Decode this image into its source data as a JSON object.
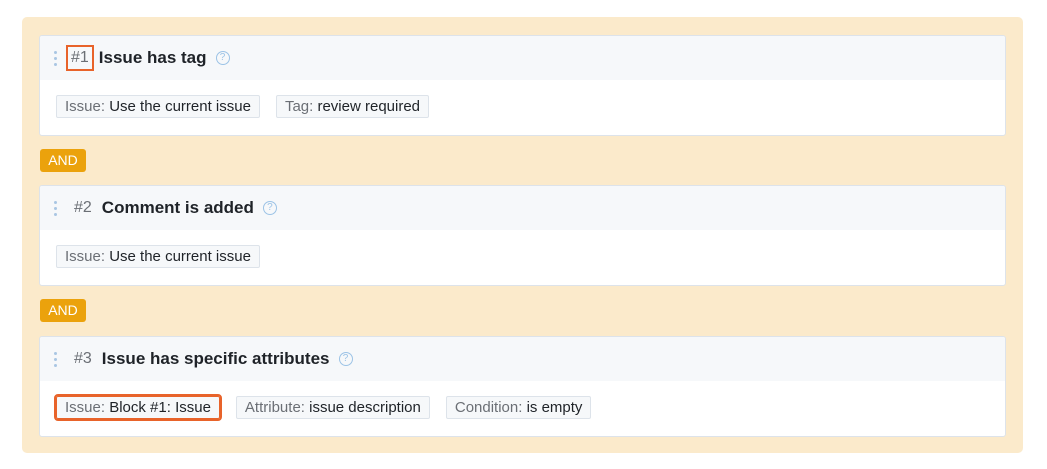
{
  "blocks": [
    {
      "number": "#1",
      "title": "Issue has tag",
      "chips": [
        {
          "k": "Issue:",
          "v": "Use the current issue"
        },
        {
          "k": "Tag:",
          "v": "review required"
        }
      ]
    },
    {
      "number": "#2",
      "title": "Comment is added",
      "chips": [
        {
          "k": "Issue:",
          "v": "Use the current issue"
        }
      ]
    },
    {
      "number": "#3",
      "title": "Issue has specific attributes",
      "chips": [
        {
          "k": "Issue:",
          "v": "Block #1: Issue"
        },
        {
          "k": "Attribute:",
          "v": "issue description"
        },
        {
          "k": "Condition:",
          "v": "is empty"
        }
      ]
    }
  ],
  "connector": "AND",
  "help_glyph": "?"
}
